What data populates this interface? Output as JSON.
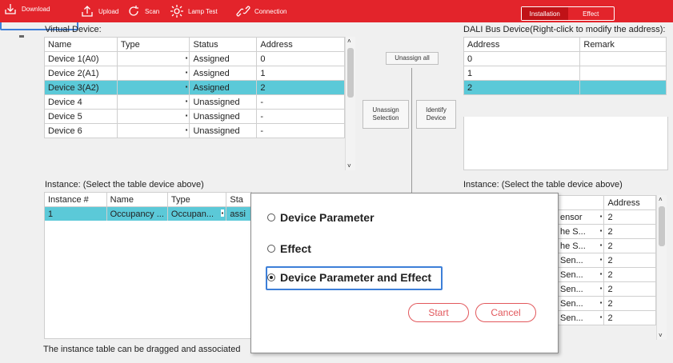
{
  "toolbar": {
    "download": "Download",
    "upload": "Upload",
    "scan": "Scan",
    "lamp_test": "Lamp Test",
    "connection": "Connection",
    "mode_installation": "Installation",
    "mode_effect": "Effect"
  },
  "virtual_device": {
    "title": "Virtual Device:",
    "headers": [
      "Name",
      "Type",
      "Status",
      "Address"
    ],
    "rows": [
      {
        "name": "Device 1(A0)",
        "type": "",
        "status": "Assigned",
        "address": "0"
      },
      {
        "name": "Device 2(A1)",
        "type": "",
        "status": "Assigned",
        "address": "1"
      },
      {
        "name": "Device 3(A2)",
        "type": "",
        "status": "Assigned",
        "address": "2"
      },
      {
        "name": "Device 4",
        "type": "",
        "status": "Unassigned",
        "address": "-"
      },
      {
        "name": "Device 5",
        "type": "",
        "status": "Unassigned",
        "address": "-"
      },
      {
        "name": "Device 6",
        "type": "",
        "status": "Unassigned",
        "address": "-"
      }
    ]
  },
  "middle": {
    "unassign_all": "Unassign all",
    "unassign_selection_1": "Unassign",
    "unassign_selection_2": "Selection",
    "identify_device_1": "Identify",
    "identify_device_2": "Device"
  },
  "dali_bus": {
    "title": "DALI Bus Device(Right-click to modify the address):",
    "headers": [
      "Address",
      "Remark"
    ],
    "rows": [
      {
        "address": "0",
        "remark": ""
      },
      {
        "address": "1",
        "remark": ""
      },
      {
        "address": "2",
        "remark": ""
      }
    ]
  },
  "instance_left": {
    "title": "Instance:   (Select the table device above)",
    "headers": [
      "Instance #",
      "Name",
      "Type",
      "Sta"
    ],
    "rows": [
      {
        "num": "1",
        "name": "Occupancy ...",
        "type": "Occupan...",
        "status": "assi"
      }
    ]
  },
  "instance_right": {
    "title": "Instance:   (Select the table device above)",
    "header_address": "Address",
    "rows": [
      {
        "type": "ensor",
        "address": "2"
      },
      {
        "type": "he S...",
        "address": "2"
      },
      {
        "type": "he S...",
        "address": "2"
      },
      {
        "type": "Sen...",
        "address": "2"
      },
      {
        "type": "Sen...",
        "address": "2"
      },
      {
        "type": "Sen...",
        "address": "2"
      },
      {
        "type": "Sen...",
        "address": "2"
      },
      {
        "type": "Sen...",
        "address": "2"
      }
    ]
  },
  "dialog": {
    "option1": "Device Parameter",
    "option2": "Effect",
    "option3": "Device Parameter and Effect",
    "selected": "Device Parameter and Effect",
    "start": "Start",
    "cancel": "Cancel"
  },
  "footer": {
    "note": "The instance table can be dragged and associated"
  },
  "colors": {
    "toolbar_red": "#e3242b",
    "selection_cyan": "#5bc9d8",
    "focus_blue": "#3d7fd8",
    "button_red": "#e2585c"
  }
}
